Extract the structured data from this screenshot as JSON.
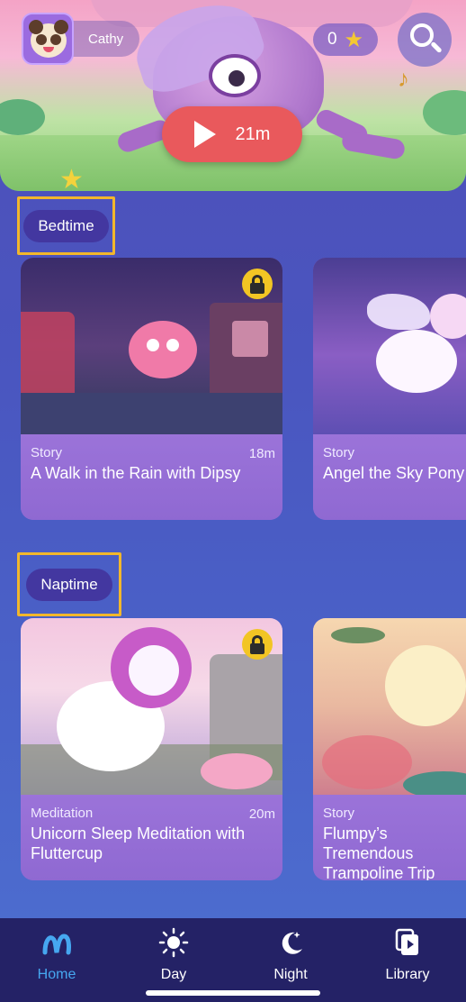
{
  "header": {
    "profile_name": "Cathy",
    "stars_count": "0",
    "play_duration": "21m"
  },
  "sections": [
    {
      "label": "Bedtime",
      "cards": [
        {
          "category": "Story",
          "duration": "18m",
          "title": "A Walk in the Rain with Dipsy",
          "locked": true
        },
        {
          "category": "Story",
          "duration": "",
          "title": "Angel the Sky Pony",
          "locked": false
        }
      ]
    },
    {
      "label": "Naptime",
      "cards": [
        {
          "category": "Meditation",
          "duration": "20m",
          "title": "Unicorn Sleep Meditation with Fluttercup",
          "locked": true
        },
        {
          "category": "Story",
          "duration": "",
          "title": "Flumpy’s Tremendous Trampoline Trip",
          "locked": false
        }
      ]
    }
  ],
  "nav": {
    "items": [
      {
        "label": "Home",
        "icon": "moshi-logo-icon",
        "active": true
      },
      {
        "label": "Day",
        "icon": "sun-icon",
        "active": false
      },
      {
        "label": "Night",
        "icon": "moon-stars-icon",
        "active": false
      },
      {
        "label": "Library",
        "icon": "library-icon",
        "active": false
      }
    ]
  },
  "colors": {
    "background": "#4a55bf",
    "play_button": "#e9595c",
    "highlight_border": "#f2b72c",
    "lock_badge": "#f2c524",
    "nav_bg": "#242266",
    "nav_active": "#46a7f0"
  }
}
